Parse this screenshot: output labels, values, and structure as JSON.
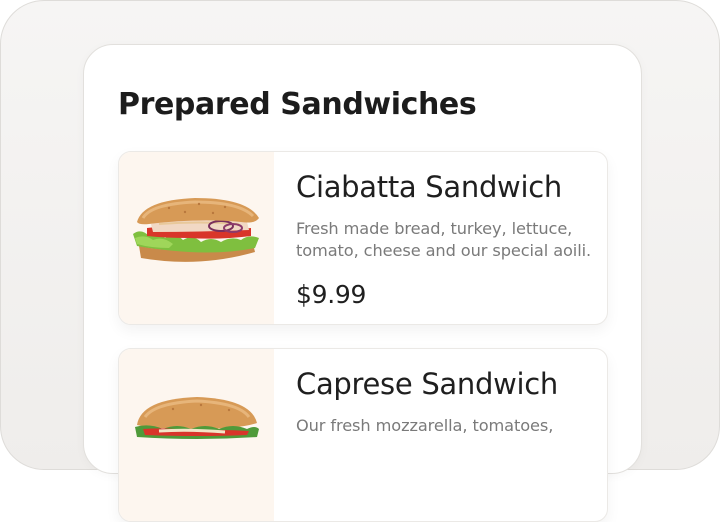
{
  "section": {
    "title": "Prepared Sandwiches"
  },
  "products": [
    {
      "name": "Ciabatta Sandwich",
      "description": "Fresh made bread, turkey, lettuce, tomato, cheese and our special aoili.",
      "price": "$9.99",
      "image_icon": "ciabatta-sandwich-image"
    },
    {
      "name": "Caprese Sandwich",
      "description": "Our fresh mozzarella, tomatoes,",
      "price": "",
      "image_icon": "caprese-sandwich-image"
    }
  ],
  "colors": {
    "background": "#f3f2f1",
    "panel": "#ffffff",
    "thumb_background": "#fdf6ef",
    "title_text": "#1c1c1c",
    "description_text": "#7a7a7a"
  }
}
